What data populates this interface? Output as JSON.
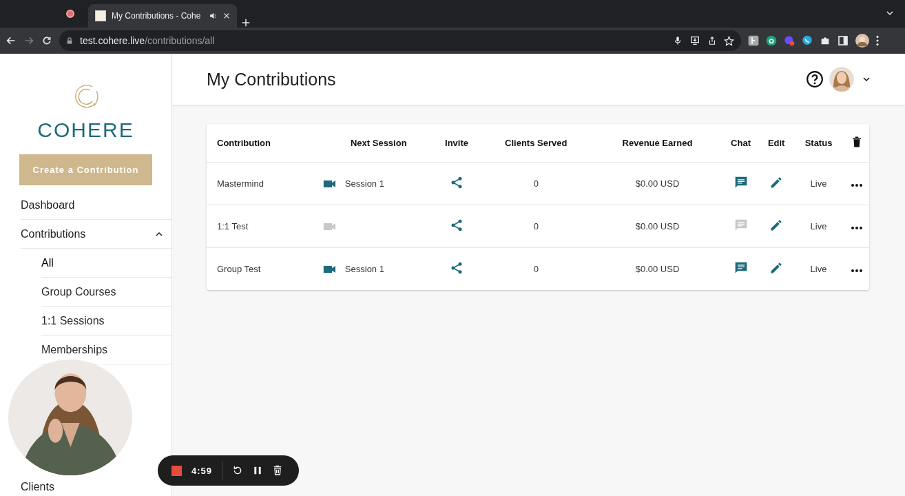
{
  "browser": {
    "tab_title": "My Contributions - Cohe",
    "url_host": "test.cohere.live",
    "url_path": "/contributions/all"
  },
  "sidebar": {
    "logo_text": "COHERE",
    "create_button": "Create a Contribution",
    "items": [
      {
        "label": "Dashboard"
      },
      {
        "label": "Contributions",
        "expanded": true,
        "children": [
          {
            "label": "All",
            "selected": true
          },
          {
            "label": "Group Courses",
            "selected": false
          },
          {
            "label": "1:1 Sessions",
            "selected": false
          },
          {
            "label": "Memberships",
            "selected": false
          }
        ]
      }
    ],
    "bottom_item": "Clients"
  },
  "header": {
    "title": "My Contributions"
  },
  "table": {
    "columns": [
      "Contribution",
      "Next Session",
      "Invite",
      "Clients Served",
      "Revenue Earned",
      "Chat",
      "Edit",
      "Status"
    ],
    "rows": [
      {
        "contribution": "Mastermind",
        "has_session": true,
        "next_session": "Session 1",
        "clients_served": "0",
        "revenue": "$0.00 USD",
        "chat_enabled": true,
        "status": "Live"
      },
      {
        "contribution": "1:1 Test",
        "has_session": false,
        "next_session": "",
        "clients_served": "0",
        "revenue": "$0.00 USD",
        "chat_enabled": false,
        "status": "Live"
      },
      {
        "contribution": "Group Test",
        "has_session": true,
        "next_session": "Session 1",
        "clients_served": "0",
        "revenue": "$0.00 USD",
        "chat_enabled": true,
        "status": "Live"
      }
    ]
  },
  "recorder": {
    "time": "4:59"
  }
}
